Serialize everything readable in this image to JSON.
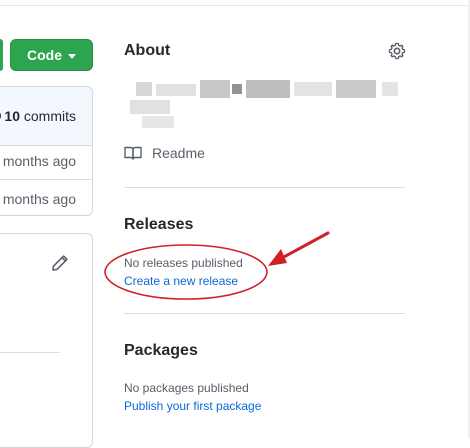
{
  "code_button": {
    "label": "Code"
  },
  "commits": {
    "count": "10",
    "label": "commits"
  },
  "commit_rows": [
    "months ago",
    "months ago"
  ],
  "about": {
    "title": "About",
    "readme_label": "Readme"
  },
  "releases": {
    "title": "Releases",
    "empty_text": "No releases published",
    "create_link": "Create a new release"
  },
  "packages": {
    "title": "Packages",
    "empty_text": "No packages published",
    "publish_link": "Publish your first package"
  },
  "colors": {
    "green": "#2da44e",
    "link": "#0969da",
    "annotation_red": "#d0202a"
  },
  "icons": [
    "chevron-down-icon",
    "history-icon",
    "pencil-icon",
    "gear-icon",
    "book-icon"
  ]
}
